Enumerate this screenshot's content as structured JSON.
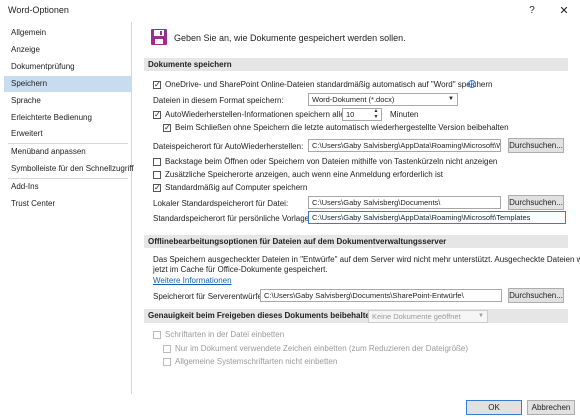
{
  "window": {
    "title": "Word-Optionen",
    "help": "?",
    "close": "✕"
  },
  "sidebar": {
    "items": [
      "Allgemein",
      "Anzeige",
      "Dokumentprüfung",
      "Speichern",
      "Sprache",
      "Erleichterte Bedienung",
      "Erweitert",
      "Menüband anpassen",
      "Symbolleiste für den Schnellzugriff",
      "Add-Ins",
      "Trust Center"
    ],
    "selected": "Speichern"
  },
  "header": {
    "intro": "Geben Sie an, wie Dokumente gespeichert werden sollen."
  },
  "save_docs": {
    "heading": "Dokumente speichern",
    "onedrive_label": "OneDrive- und SharePoint Online-Dateien standardmäßig automatisch auf \"Word\" speichern",
    "format_label": "Dateien in diesem Format speichern:",
    "format_value": "Word-Dokument (*.docx)",
    "autorecover_label": "AutoWiederherstellen-Informationen speichern alle",
    "autorecover_value": "10",
    "minutes_label": "Minuten",
    "keep_last_label": "Beim Schließen ohne Speichern die letzte automatisch wiederhergestellte Version beibehalten",
    "autorecover_path_label": "Dateispeicherort für AutoWiederherstellen:",
    "autorecover_path_value": "C:\\Users\\Gaby Salvisberg\\AppData\\Roaming\\Microsoft\\Word\\",
    "browse_label": "Durchsuchen...",
    "backstage_label": "Backstage beim Öffnen oder Speichern von Dateien mithilfe von Tastenkürzeln nicht anzeigen",
    "extra_locations_label": "Zusätzliche Speicherorte anzeigen, auch wenn eine Anmeldung erforderlich ist",
    "default_computer_label": "Standardmäßig auf Computer speichern",
    "local_default_label": "Lokaler Standardspeicherort für Datei:",
    "local_default_value": "C:\\Users\\Gaby Salvisberg\\Documents\\",
    "browse2_label": "Durchsuchen...",
    "templates_label": "Standardspeicherort für persönliche Vorlagen:",
    "templates_value": "C:\\Users\\Gaby Salvisberg\\AppData\\Roaming\\Microsoft\\Templates"
  },
  "offline": {
    "heading": "Offlinebearbeitungsoptionen für Dateien auf dem Dokumentverwaltungsserver",
    "text1": "Das Speichern ausgecheckter Dateien in \"Entwürfe\" auf dem Server wird nicht mehr unterstützt. Ausgecheckte Dateien werden",
    "text2": "jetzt im Cache für Office-Dokumente gespeichert.",
    "more_info": "Weitere Informationen",
    "drafts_label": "Speicherort für Serverentwürfe:",
    "drafts_value": "C:\\Users\\Gaby Salvisberg\\Documents\\SharePoint-Entwürfe\\",
    "browse_label": "Durchsuchen..."
  },
  "fidelity": {
    "heading": "Genauigkeit beim Freigeben dieses Dokuments beibehalten:",
    "doc_select": "Keine Dokumente geöffnet",
    "embed_fonts": "Schriftarten in der Datei einbetten",
    "embed_used_chars": "Nur im Dokument verwendete Zeichen einbetten (zum Reduzieren der Dateigröße)",
    "no_system_fonts": "Allgemeine Systemschriftarten nicht einbetten"
  },
  "footer": {
    "ok": "OK",
    "cancel": "Abbrechen"
  },
  "colors": {
    "accent": "#3b7bd6",
    "selected_nav": "#c7dcef",
    "save_icon": "#9b2e8e"
  }
}
